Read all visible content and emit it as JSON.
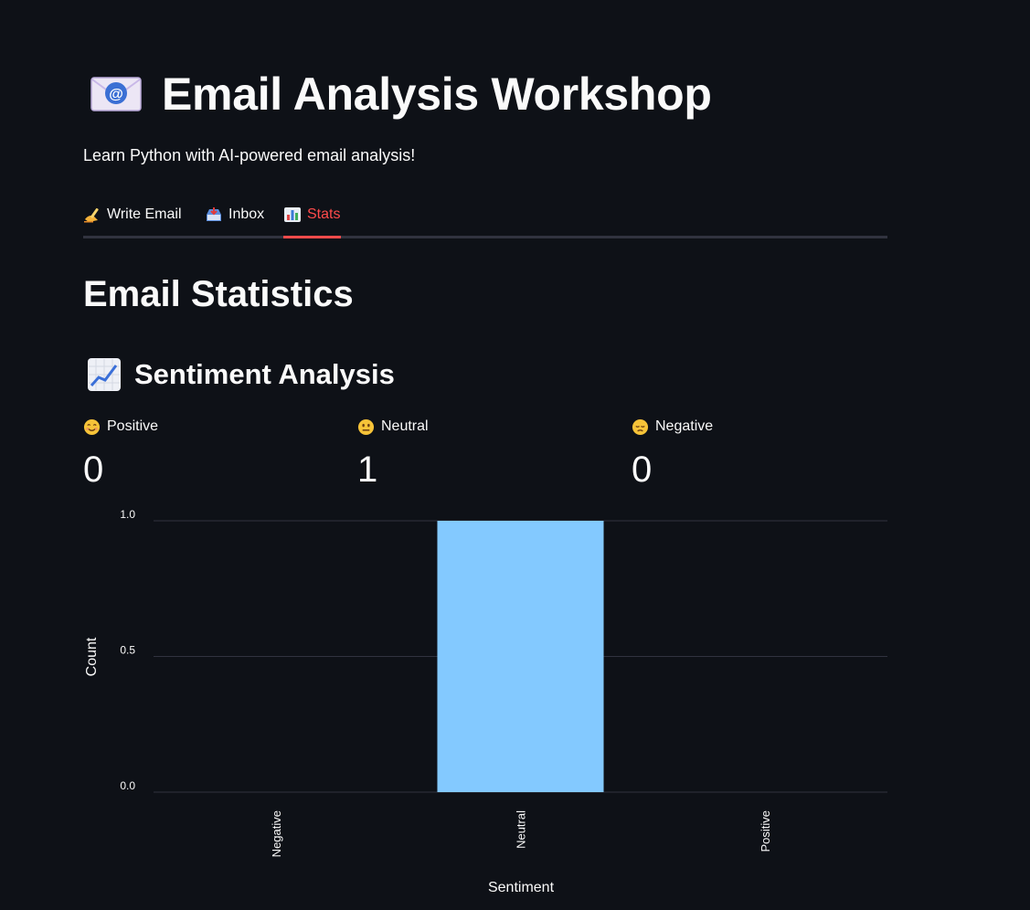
{
  "app": {
    "title": "Email Analysis Workshop",
    "subtitle": "Learn Python with AI-powered email analysis!",
    "icon": "email-at-icon"
  },
  "tabs": [
    {
      "label": "Write Email",
      "icon": "writing-hand-icon",
      "active": false
    },
    {
      "label": "Inbox",
      "icon": "inbox-tray-icon",
      "active": false
    },
    {
      "label": "Stats",
      "icon": "bar-chart-icon",
      "active": true
    }
  ],
  "main": {
    "section_title": "Email Statistics",
    "subsection_title": "Sentiment Analysis",
    "subsection_icon": "chart-increasing-icon"
  },
  "metrics": [
    {
      "label": "Positive",
      "value": "0",
      "icon": "smiling-face-icon"
    },
    {
      "label": "Neutral",
      "value": "1",
      "icon": "neutral-face-icon"
    },
    {
      "label": "Negative",
      "value": "0",
      "icon": "pensive-face-icon"
    }
  ],
  "colors": {
    "background": "#0e1117",
    "text": "#fafafa",
    "accent": "#ff4b4b",
    "bar": "#83c9ff",
    "grid": "#31333f"
  },
  "chart_data": {
    "type": "bar",
    "categories": [
      "Negative",
      "Neutral",
      "Positive"
    ],
    "values": [
      0,
      1,
      0
    ],
    "xlabel": "Sentiment",
    "ylabel": "Count",
    "ylim": [
      0,
      1
    ],
    "yticks": [
      "0.0",
      "0.5",
      "1.0"
    ],
    "grid": true
  }
}
